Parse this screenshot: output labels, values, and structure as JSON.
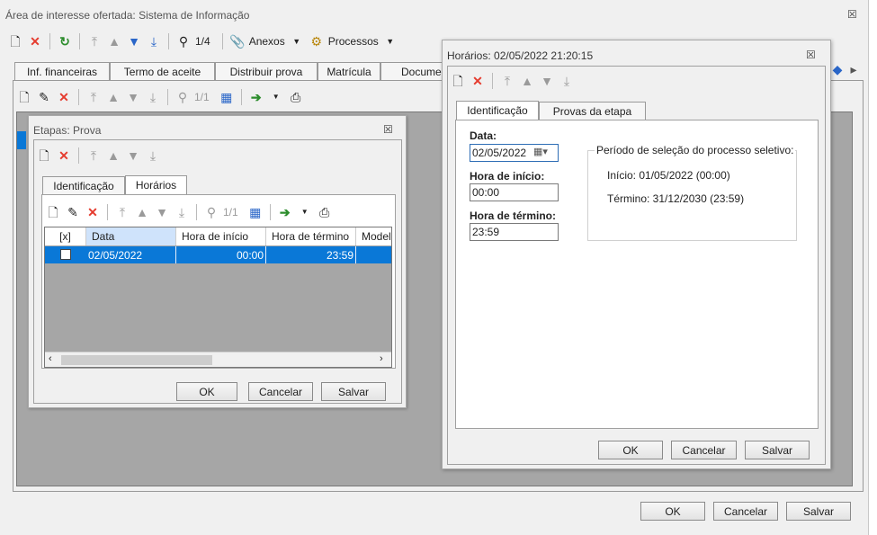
{
  "main": {
    "title": "Área de interesse ofertada: Sistema de Informação",
    "close": "☒",
    "nav_counter": "1/4",
    "anexos": "Anexos",
    "processos": "Processos",
    "tabs": [
      "Inf. financeiras",
      "Termo de aceite",
      "Distribuir prova",
      "Matrícula",
      "Documen"
    ],
    "counter": "1/1",
    "buttons": {
      "ok": "OK",
      "cancel": "Cancelar",
      "save": "Salvar"
    }
  },
  "etapas": {
    "title": "Etapas: Prova",
    "close": "☒",
    "tabs": [
      "Identificação",
      "Horários"
    ],
    "counter": "1/1",
    "columns": [
      "[x]",
      "Data",
      "Hora de início",
      "Hora de término",
      "Modelo"
    ],
    "rows": [
      {
        "date": "02/05/2022",
        "start": "00:00",
        "end": "23:59"
      }
    ],
    "buttons": {
      "ok": "OK",
      "cancel": "Cancelar",
      "save": "Salvar"
    }
  },
  "horarios": {
    "title": "Horários: 02/05/2022 21:20:15",
    "close": "☒",
    "tabs": [
      "Identificação",
      "Provas da etapa"
    ],
    "data_label": "Data:",
    "data_value": "02/05/2022",
    "start_label": "Hora de início:",
    "start_value": "00:00",
    "end_label": "Hora de término:",
    "end_value": "23:59",
    "period_title": "Período de seleção do processo seletivo:",
    "period_start": "Início: 01/05/2022 (00:00)",
    "period_end": "Término: 31/12/2030 (23:59)",
    "buttons": {
      "ok": "OK",
      "cancel": "Cancelar",
      "save": "Salvar"
    }
  },
  "colors": {
    "selection": "#0a78d7",
    "header_sel": "#cfe3fb",
    "grey_area": "#a6a6a6"
  }
}
